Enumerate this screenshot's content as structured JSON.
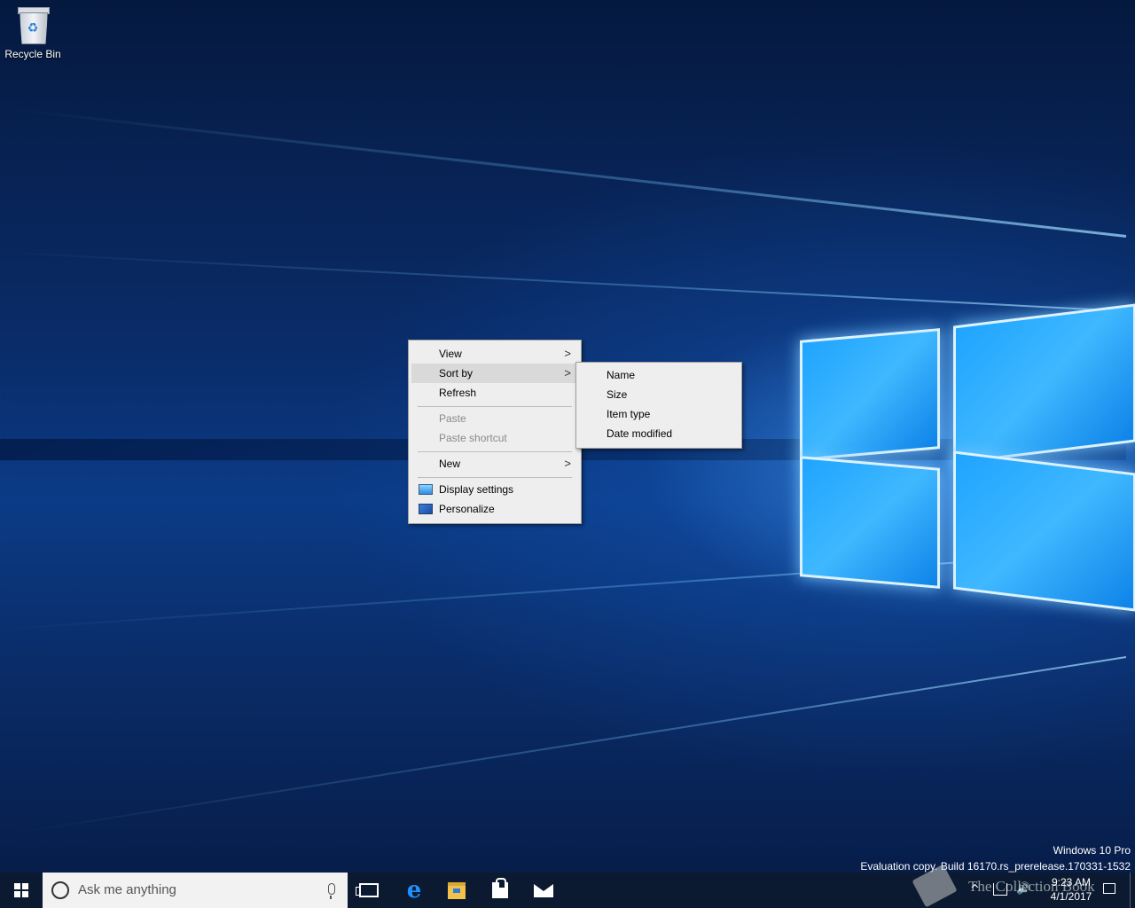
{
  "desktop": {
    "icons": [
      {
        "label": "Recycle Bin",
        "icon": "recycle-bin-icon"
      }
    ]
  },
  "context_menu": {
    "items": [
      {
        "label": "View",
        "submenu": true
      },
      {
        "label": "Sort by",
        "submenu": true,
        "highlighted": true
      },
      {
        "label": "Refresh"
      },
      {
        "label": "Paste",
        "disabled": true
      },
      {
        "label": "Paste shortcut",
        "disabled": true
      },
      {
        "label": "New",
        "submenu": true
      },
      {
        "label": "Display settings",
        "icon": "display-settings-icon"
      },
      {
        "label": "Personalize",
        "icon": "personalize-icon"
      }
    ]
  },
  "sort_by_submenu": {
    "items": [
      {
        "label": "Name"
      },
      {
        "label": "Size"
      },
      {
        "label": "Item type"
      },
      {
        "label": "Date modified"
      }
    ]
  },
  "watermark": {
    "line1": "Windows 10 Pro",
    "line2": "Evaluation copy. Build 16170.rs_prerelease.170331-1532"
  },
  "taskbar": {
    "search_placeholder": "Ask me anything",
    "apps": [
      "task-view-icon",
      "edge-icon",
      "file-explorer-icon",
      "store-icon",
      "mail-icon"
    ],
    "tray": {
      "time": "9:23 AM",
      "date": "4/1/2017"
    }
  },
  "overlay_watermark": {
    "text": "The Collection Book"
  },
  "colors": {
    "taskbar": "#0b1a30",
    "menu_bg": "#eeeeee",
    "menu_highlight": "#d9d9d9",
    "accent": "#1e90ff"
  }
}
